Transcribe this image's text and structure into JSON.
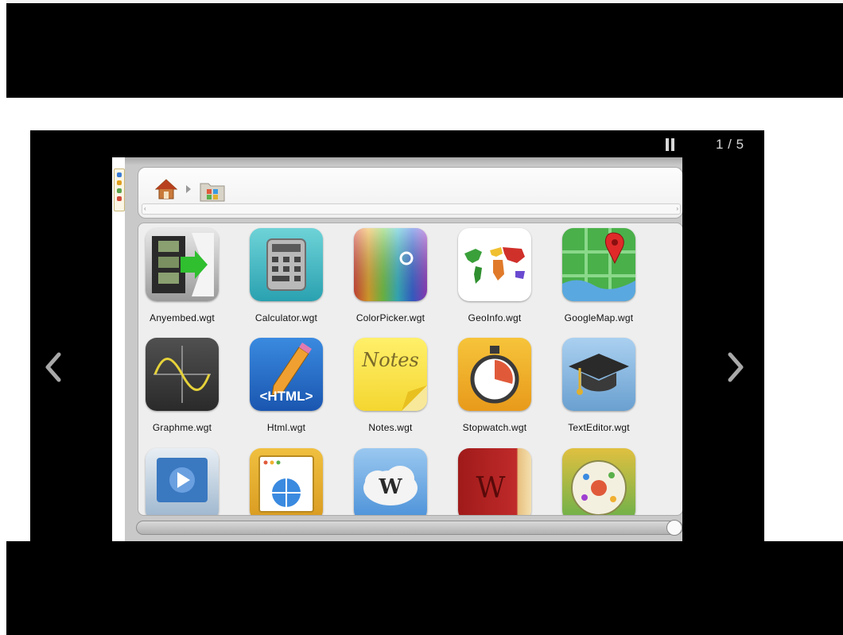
{
  "slideshow": {
    "counter": "1 / 5",
    "pause_icon": "pause-icon",
    "prev_icon": "chevron-left-icon",
    "next_icon": "chevron-right-icon"
  },
  "breadcrumb": {
    "home_icon": "home-icon",
    "folder_icon": "widgets-folder-icon"
  },
  "apps": [
    {
      "label": "Anyembed.wgt",
      "icon": "anyembed-icon"
    },
    {
      "label": "Calculator.wgt",
      "icon": "calculator-icon"
    },
    {
      "label": "ColorPicker.wgt",
      "icon": "color-picker-icon"
    },
    {
      "label": "GeoInfo.wgt",
      "icon": "world-map-icon"
    },
    {
      "label": "GoogleMap.wgt",
      "icon": "google-map-icon"
    },
    {
      "label": "Graphme.wgt",
      "icon": "graph-icon"
    },
    {
      "label": "Html.wgt",
      "icon": "html-icon",
      "icon_text": "<HTML>"
    },
    {
      "label": "Notes.wgt",
      "icon": "notes-icon",
      "icon_text": "Notes"
    },
    {
      "label": "Stopwatch.wgt",
      "icon": "stopwatch-icon"
    },
    {
      "label": "TextEditor.wgt",
      "icon": "graduation-cap-icon"
    },
    {
      "label": "",
      "icon": "video-player-icon"
    },
    {
      "label": "",
      "icon": "web-browser-icon"
    },
    {
      "label": "",
      "icon": "wiki-cloud-icon",
      "icon_text": "W"
    },
    {
      "label": "",
      "icon": "wikipedia-book-icon",
      "icon_text": "W"
    },
    {
      "label": "",
      "icon": "colorful-map-icon"
    }
  ],
  "colors": {
    "slideshow_bg": "#000000",
    "counter_text": "#d8d8d8",
    "panel_bg": "#eeeeee"
  }
}
